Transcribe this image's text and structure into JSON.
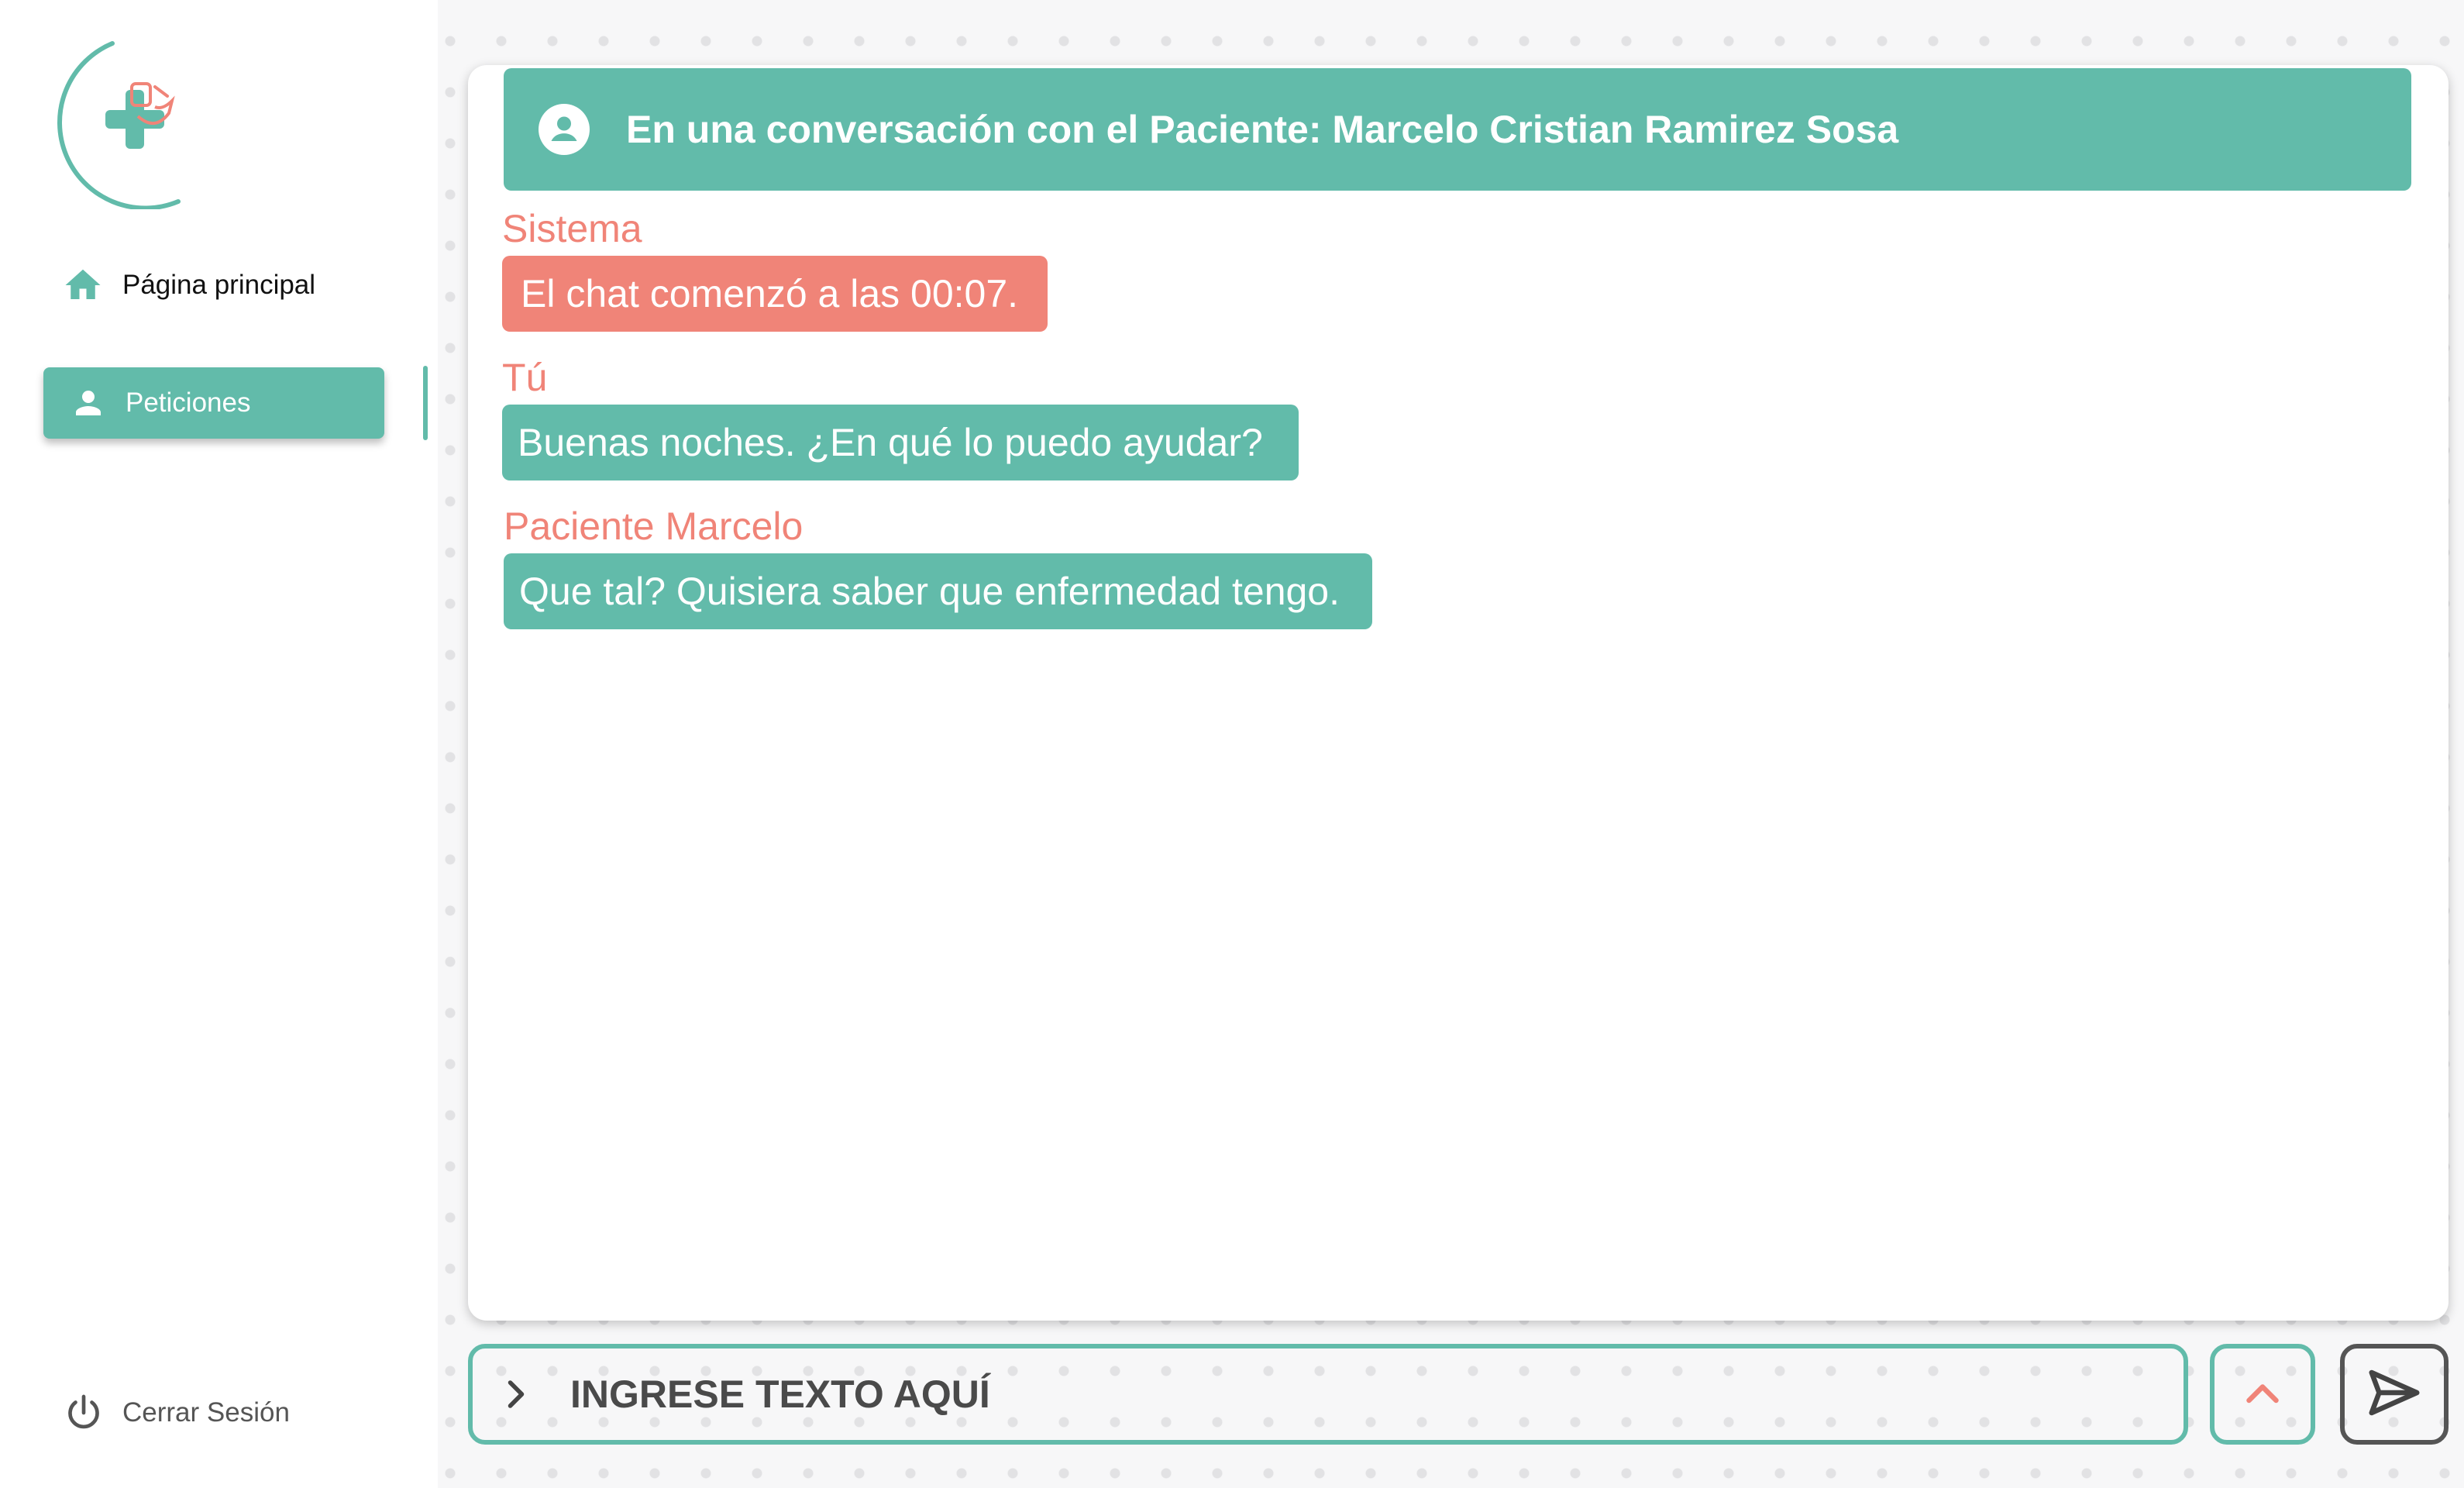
{
  "sidebar": {
    "items": [
      {
        "label": "Página principal",
        "icon": "home-icon"
      },
      {
        "label": "Peticiones",
        "icon": "person-icon",
        "active": true
      }
    ],
    "logout_label": "Cerrar Sesión"
  },
  "chat": {
    "header_title": "En una conversación con el Paciente: Marcelo Cristian Ramirez Sosa",
    "messages": [
      {
        "sender": "Sistema",
        "text": "El chat comenzó a las 00:07.",
        "style": "system"
      },
      {
        "sender": "Tú",
        "text": "Buenas noches. ¿En qué lo puedo ayudar?",
        "style": "own"
      },
      {
        "sender": "Paciente Marcelo",
        "text": "Que tal? Quisiera saber que enfermedad tengo.",
        "style": "patient"
      }
    ]
  },
  "input": {
    "placeholder": "INGRESE TEXTO AQUÍ",
    "value": ""
  },
  "colors": {
    "accent": "#62bbaa",
    "system": "#f08478",
    "text_dark": "#111111"
  }
}
